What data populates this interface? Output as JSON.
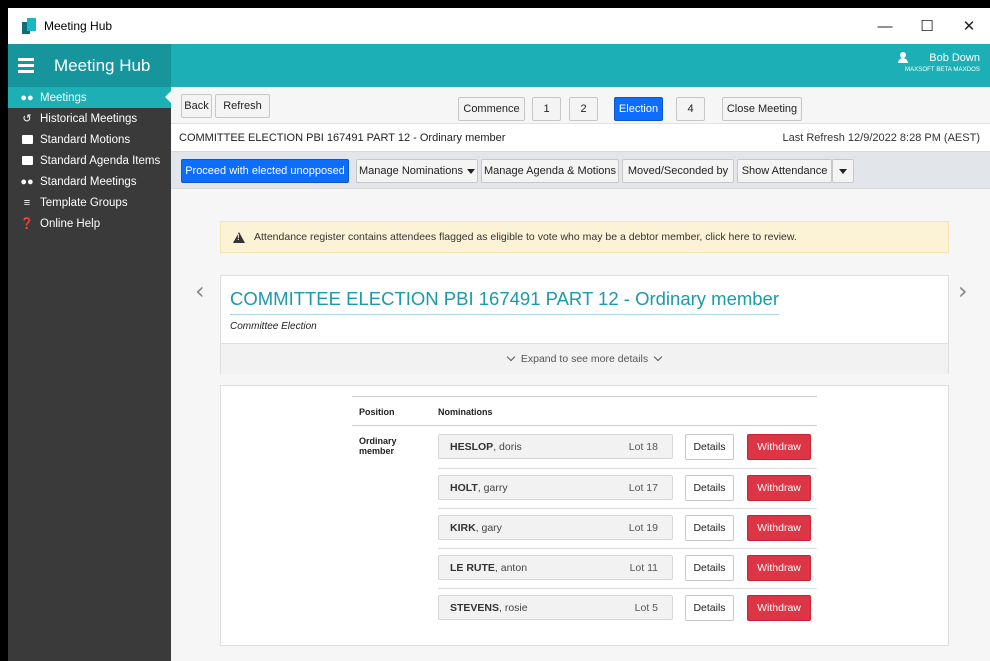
{
  "window": {
    "title": "Meeting Hub",
    "minimize": "—",
    "maximize": "☐",
    "close": "✕"
  },
  "header": {
    "brand": "Meeting Hub",
    "user_name": "Bob Down",
    "user_org": "MAXSOFT BETA MAXDOS"
  },
  "sidebar": {
    "items": [
      {
        "label": "Meetings",
        "icon": "users-icon",
        "active": true
      },
      {
        "label": "Historical Meetings",
        "icon": "history-icon",
        "active": false
      },
      {
        "label": "Standard Motions",
        "icon": "gavel-icon",
        "active": false
      },
      {
        "label": "Standard Agenda Items",
        "icon": "bookmark-icon",
        "active": false
      },
      {
        "label": "Standard Meetings",
        "icon": "group-icon",
        "active": false
      },
      {
        "label": "Template Groups",
        "icon": "layers-icon",
        "active": false
      },
      {
        "label": "Online Help",
        "icon": "help-icon",
        "active": false
      }
    ]
  },
  "topbar": {
    "back": "Back",
    "refresh": "Refresh",
    "steps": [
      "Commence",
      "1",
      "2",
      "Election",
      "4",
      "Close Meeting"
    ],
    "active_step": "Election"
  },
  "subtitle": {
    "meeting": "COMMITTEE ELECTION PBI 167491 PART 12 - Ordinary member",
    "last_refresh": "Last Refresh 12/9/2022 8:28 PM (AEST)"
  },
  "toolbar": {
    "proceed": "Proceed with elected unopposed",
    "manage_nominations": "Manage Nominations",
    "manage_agenda": "Manage Agenda & Motions",
    "moved_seconded": "Moved/Seconded by",
    "show_attendance": "Show Attendance"
  },
  "warning": {
    "text": "Attendance register contains attendees flagged as eligible to vote who may be a debtor member, click here to review."
  },
  "card": {
    "title": "COMMITTEE ELECTION PBI 167491 PART 12 - Ordinary member",
    "type": "Committee Election",
    "expand": "Expand to see more details"
  },
  "nominations": {
    "col_position": "Position",
    "col_nominations": "Nominations",
    "position_label": [
      "Ordinary",
      "member"
    ],
    "details_label": "Details",
    "withdraw_label": "Withdraw",
    "rows": [
      {
        "surname": "HESLOP",
        "given": ", doris",
        "lot": "Lot 18"
      },
      {
        "surname": "HOLT",
        "given": ", garry",
        "lot": "Lot 17"
      },
      {
        "surname": "KIRK",
        "given": ", gary",
        "lot": "Lot 19"
      },
      {
        "surname": "LE RUTE",
        "given": ", anton",
        "lot": "Lot 11"
      },
      {
        "surname": "STEVENS",
        "given": ", rosie",
        "lot": "Lot 5"
      }
    ]
  },
  "colors": {
    "accent": "#1cb0b6",
    "primary": "#0d6efd",
    "danger": "#dc3545",
    "sidebar": "#3a3a3a"
  }
}
